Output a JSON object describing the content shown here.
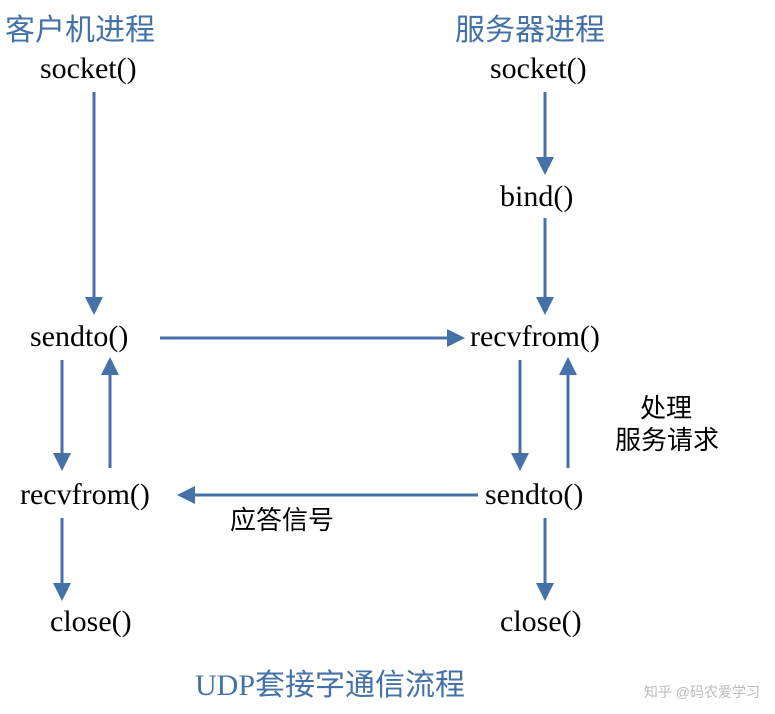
{
  "headers": {
    "client": "客户机进程",
    "server": "服务器进程"
  },
  "client": {
    "socket": "socket()",
    "sendto": "sendto()",
    "recvfrom": "recvfrom()",
    "close": "close()"
  },
  "server": {
    "socket": "socket()",
    "bind": "bind()",
    "recvfrom": "recvfrom()",
    "sendto": "sendto()",
    "close": "close()"
  },
  "labels": {
    "response": "应答信号",
    "process_line1": "处理",
    "process_line2": "服务请求"
  },
  "caption": "UDP套接字通信流程",
  "watermark": "知乎 @码农爱学习"
}
